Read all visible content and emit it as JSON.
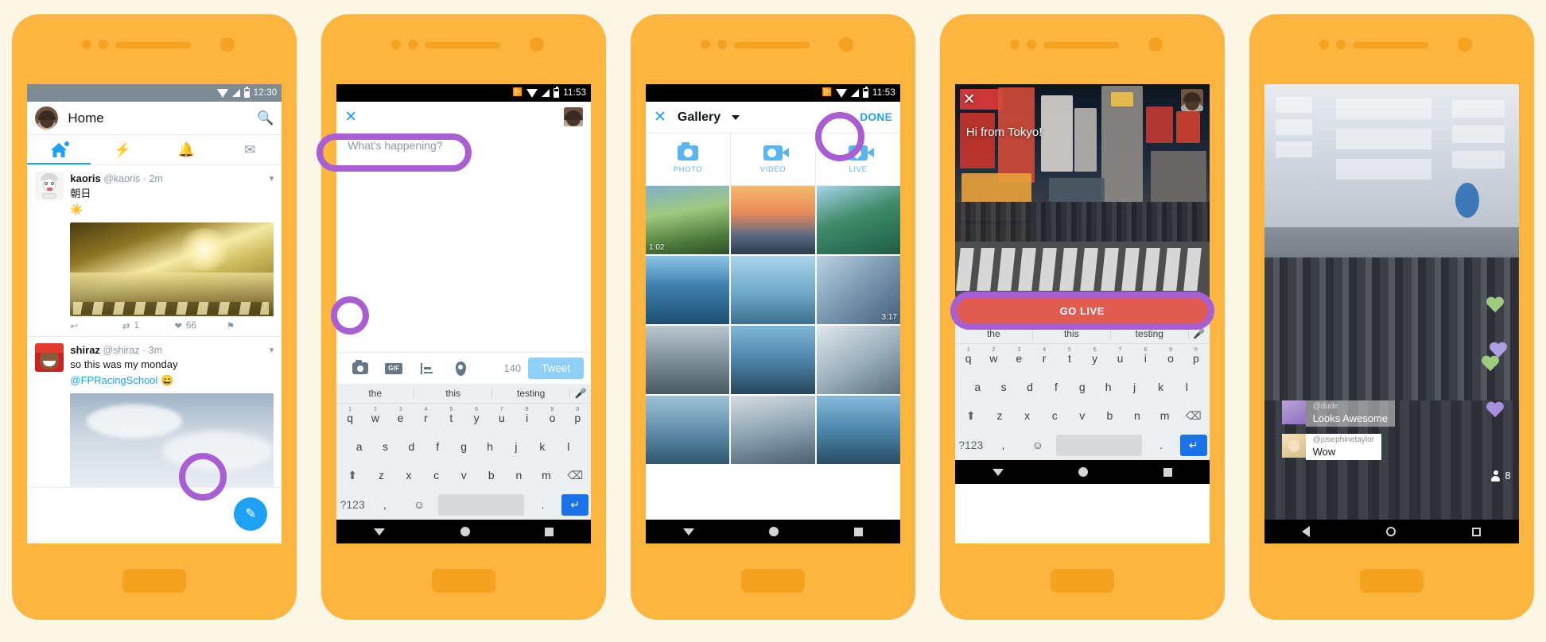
{
  "phone1": {
    "name": "twitter-home",
    "status": {
      "time": "12:30"
    },
    "appbar": {
      "title": "Home",
      "search_icon": "search-icon"
    },
    "tabs": [
      {
        "name": "home",
        "icon": "home-icon",
        "active": true
      },
      {
        "name": "moments",
        "icon": "lightning-icon",
        "active": false
      },
      {
        "name": "notifications",
        "icon": "bell-icon",
        "active": false
      },
      {
        "name": "messages",
        "icon": "envelope-icon",
        "active": false
      }
    ],
    "tweets": [
      {
        "name": "kaoris",
        "handle": "@kaoris",
        "time": "2m",
        "text": "朝日",
        "emoji": "☀️",
        "reply_count": "",
        "retweet_count": "1",
        "like_count": "66"
      },
      {
        "name": "shiraz",
        "handle": "@shiraz",
        "time": "3m",
        "text": "so this was my monday",
        "mention": "@FPRacingSchool",
        "emoji": "😄"
      }
    ],
    "compose_fab": "compose-icon"
  },
  "phone2": {
    "name": "tweet-compose",
    "status": {
      "time": "11:53"
    },
    "close_label": "✕",
    "placeholder": "What's happening?",
    "toolbar": {
      "camera": "camera-icon",
      "gif": "GIF",
      "poll": "poll-icon",
      "location": "location-pin-icon",
      "char_count": "140",
      "tweet_label": "Tweet"
    },
    "keyboard": {
      "suggestions": [
        "the",
        "this",
        "testing"
      ],
      "mic_icon": "microphone-icon",
      "row1": [
        {
          "k": "q",
          "n": "1"
        },
        {
          "k": "w",
          "n": "2"
        },
        {
          "k": "e",
          "n": "3"
        },
        {
          "k": "r",
          "n": "4"
        },
        {
          "k": "t",
          "n": "5"
        },
        {
          "k": "y",
          "n": "6"
        },
        {
          "k": "u",
          "n": "7"
        },
        {
          "k": "i",
          "n": "8"
        },
        {
          "k": "o",
          "n": "9"
        },
        {
          "k": "p",
          "n": "0"
        }
      ],
      "row2": [
        "a",
        "s",
        "d",
        "f",
        "g",
        "h",
        "j",
        "k",
        "l"
      ],
      "row3": [
        "z",
        "x",
        "c",
        "v",
        "b",
        "n",
        "m"
      ],
      "shift": "⬆",
      "backspace": "⌫",
      "symbols": "?123",
      "comma": ",",
      "emoji": "☺",
      "space": "",
      "period": ".",
      "enter": "↵"
    },
    "navbar": {
      "back": "back-triangle-icon",
      "home": "home-circle-icon",
      "recents": "recents-square-icon"
    }
  },
  "phone3": {
    "name": "gallery-picker",
    "status": {
      "time": "11:53"
    },
    "header": {
      "close": "✕",
      "title": "Gallery",
      "caret": "chevron-down-icon",
      "done": "DONE"
    },
    "modes": [
      {
        "label": "PHOTO",
        "icon": "photo-camera-icon"
      },
      {
        "label": "VIDEO",
        "icon": "video-camera-icon"
      },
      {
        "label": "LIVE",
        "icon": "periscope-live-icon"
      }
    ],
    "grid": [
      {
        "name": "lake-hills-thumb",
        "duration": "1:02"
      },
      {
        "name": "tower-sunset-thumb",
        "duration": ""
      },
      {
        "name": "kayak-coast-thumb",
        "duration": ""
      },
      {
        "name": "mountain-lake-thumb",
        "duration": ""
      },
      {
        "name": "skytower-city-thumb",
        "duration": ""
      },
      {
        "name": "glass-building-thumb",
        "duration": "3:17"
      },
      {
        "name": "observatory-thumb",
        "duration": ""
      },
      {
        "name": "skytower-night-thumb",
        "duration": ""
      },
      {
        "name": "office-tower-thumb",
        "duration": ""
      },
      {
        "name": "harbour-thumb",
        "duration": ""
      },
      {
        "name": "bridge-thumb",
        "duration": ""
      },
      {
        "name": "skyline-thumb",
        "duration": ""
      }
    ],
    "navbar": {
      "back": "back-triangle-icon",
      "home": "home-circle-icon",
      "recents": "recents-square-icon"
    }
  },
  "phone4": {
    "name": "go-live-preview",
    "status": {
      "time": "11:53"
    },
    "close": "✕",
    "caption": "Hi from Tokyo!",
    "go_live_label": "GO LIVE",
    "go_live_color": "#e05b52",
    "keyboard": {
      "suggestions": [
        "the",
        "this",
        "testing"
      ],
      "mic_icon": "microphone-icon",
      "row1": [
        {
          "k": "q",
          "n": "1"
        },
        {
          "k": "w",
          "n": "2"
        },
        {
          "k": "e",
          "n": "3"
        },
        {
          "k": "r",
          "n": "4"
        },
        {
          "k": "t",
          "n": "5"
        },
        {
          "k": "y",
          "n": "6"
        },
        {
          "k": "u",
          "n": "7"
        },
        {
          "k": "i",
          "n": "8"
        },
        {
          "k": "o",
          "n": "9"
        },
        {
          "k": "p",
          "n": "0"
        }
      ],
      "row2": [
        "a",
        "s",
        "d",
        "f",
        "g",
        "h",
        "j",
        "k",
        "l"
      ],
      "row3": [
        "z",
        "x",
        "c",
        "v",
        "b",
        "n",
        "m"
      ],
      "shift": "⬆",
      "backspace": "⌫",
      "symbols": "?123",
      "comma": ",",
      "emoji": "☺",
      "period": ".",
      "enter": "↵"
    },
    "navbar": {
      "back": "back-triangle-icon",
      "home": "home-circle-icon",
      "recents": "recents-square-icon"
    }
  },
  "phone5": {
    "name": "live-broadcast",
    "comments": [
      {
        "user": "@dude",
        "text": "Looks Awesome",
        "style": "semi"
      },
      {
        "user": "@josephinetaylor",
        "text": "Wow",
        "style": "solid"
      }
    ],
    "viewers": {
      "count": "8",
      "icon": "person-icon"
    },
    "hearts": [
      {
        "color": "#9ecb7e"
      },
      {
        "color": "#b09fe0"
      },
      {
        "color": "#9ecb7e"
      },
      {
        "color": "#a98fe0"
      }
    ],
    "navbar": {
      "back": "back-triangle-icon",
      "home": "home-circle-icon",
      "recents": "recents-square-icon"
    }
  },
  "theme": {
    "phone_body": "#fcb63f",
    "highlight_ring": "#a95fd4",
    "twitter_blue": "#1da1f2",
    "page_bg": "#fbf6e6"
  }
}
